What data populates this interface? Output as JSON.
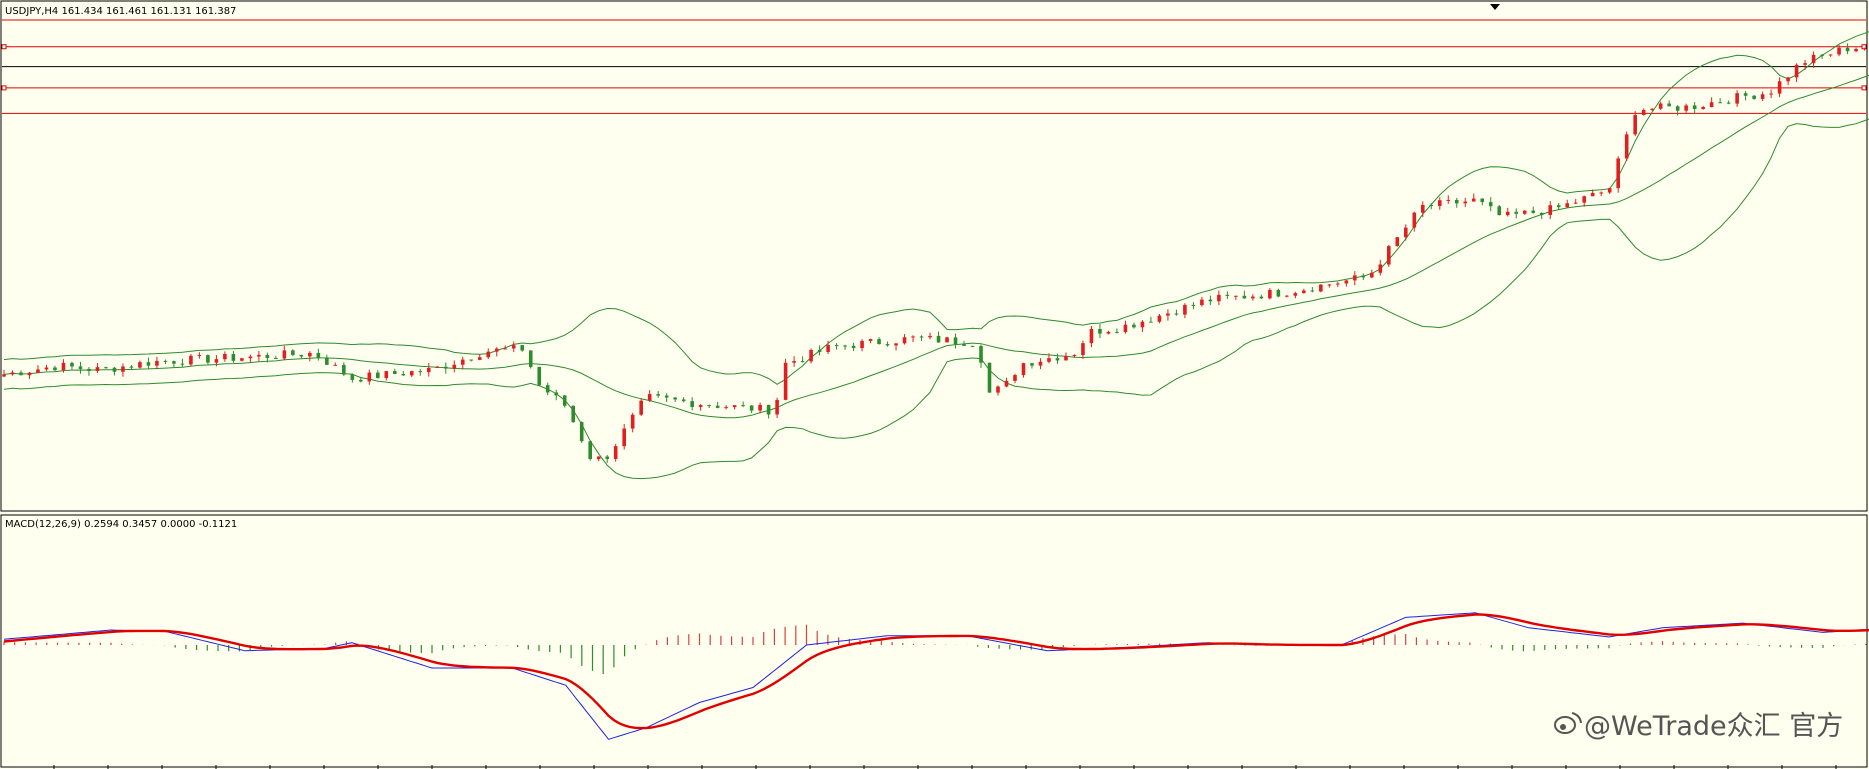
{
  "chart_data": {
    "type": "candlestick",
    "symbol_info": "USDJPY,H4  161.434 161.461 161.131 161.387",
    "indicator_info": "MACD(12,26,9) 0.2594 0.3457 0.0000 -0.1121",
    "price_range": [
      150.5,
      162.4
    ],
    "horizontal_levels": {
      "red": [
        162.0,
        161.37,
        160.4,
        159.8
      ],
      "black": [
        160.9
      ]
    },
    "candle_bars": 234,
    "anchors": [
      [
        0,
        153.65
      ],
      [
        10,
        153.85
      ],
      [
        18,
        153.75
      ],
      [
        28,
        153.95
      ],
      [
        45,
        154.05
      ],
      [
        58,
        154.15
      ],
      [
        65,
        153.55
      ],
      [
        72,
        153.65
      ],
      [
        80,
        153.75
      ],
      [
        90,
        154.2
      ],
      [
        97,
        154.25
      ],
      [
        100,
        153.4
      ],
      [
        105,
        152.9
      ],
      [
        110,
        151.6
      ],
      [
        113,
        151.75
      ],
      [
        120,
        153.1
      ],
      [
        135,
        152.9
      ],
      [
        144,
        152.8
      ],
      [
        146,
        153.9
      ],
      [
        155,
        154.3
      ],
      [
        170,
        154.5
      ],
      [
        182,
        154.4
      ],
      [
        184,
        153.2
      ],
      [
        187,
        153.35
      ],
      [
        190,
        153.9
      ],
      [
        200,
        154.15
      ],
      [
        203,
        154.65
      ],
      [
        210,
        154.8
      ],
      [
        225,
        155.4
      ],
      [
        240,
        155.6
      ],
      [
        255,
        155.95
      ],
      [
        265,
        157.6
      ],
      [
        275,
        157.75
      ],
      [
        280,
        157.35
      ],
      [
        290,
        157.55
      ],
      [
        300,
        158.0
      ],
      [
        305,
        159.9
      ],
      [
        315,
        159.95
      ],
      [
        325,
        160.2
      ],
      [
        330,
        160.3
      ],
      [
        336,
        161.0
      ],
      [
        345,
        161.35
      ],
      [
        355,
        161.35
      ],
      [
        365,
        161.45
      ],
      [
        370,
        161.2
      ]
    ],
    "macd": {
      "params": "12,26,9",
      "main_anchors": [
        [
          0,
          0.05
        ],
        [
          20,
          0.13
        ],
        [
          30,
          0.12
        ],
        [
          45,
          -0.05
        ],
        [
          60,
          -0.03
        ],
        [
          65,
          0.02
        ],
        [
          80,
          -0.2
        ],
        [
          95,
          -0.2
        ],
        [
          105,
          -0.35
        ],
        [
          113,
          -0.82
        ],
        [
          120,
          -0.72
        ],
        [
          130,
          -0.5
        ],
        [
          140,
          -0.37
        ],
        [
          150,
          0.0
        ],
        [
          165,
          0.08
        ],
        [
          180,
          0.08
        ],
        [
          195,
          -0.05
        ],
        [
          210,
          -0.02
        ],
        [
          225,
          0.02
        ],
        [
          235,
          0.0
        ],
        [
          250,
          0.0
        ],
        [
          262,
          0.24
        ],
        [
          275,
          0.28
        ],
        [
          285,
          0.15
        ],
        [
          300,
          0.07
        ],
        [
          310,
          0.15
        ],
        [
          325,
          0.19
        ],
        [
          340,
          0.11
        ],
        [
          350,
          0.14
        ],
        [
          360,
          0.11
        ],
        [
          371,
          -0.02
        ]
      ],
      "signal_period": 9
    }
  },
  "watermark": {
    "icon": "weibo-icon",
    "text": "@WeTrade众汇 官方"
  },
  "colors": {
    "background": "#fffff0",
    "bull_candle": "#e02020",
    "bear_candle": "#2e8b2e",
    "bollinger": "#2e8b2e",
    "macd_main": "#2222dd",
    "macd_signal": "#e00000",
    "hist_positive": "#d84040",
    "hist_negative": "#2e8b2e",
    "level_line": "#e00000"
  }
}
